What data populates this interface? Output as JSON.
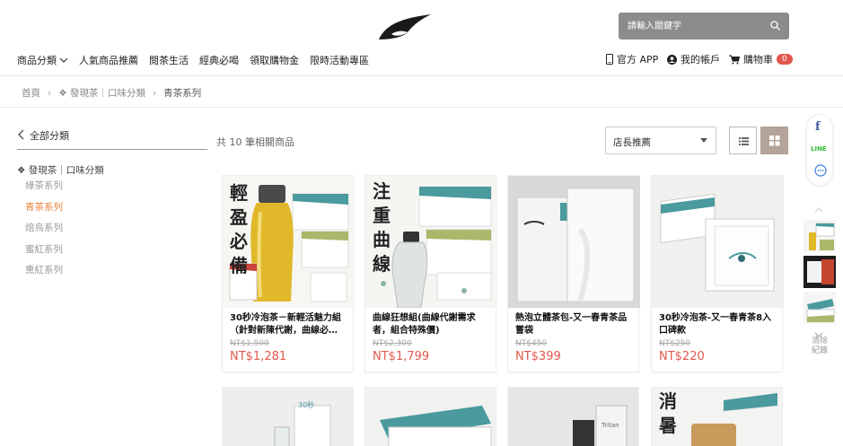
{
  "search": {
    "placeholder": "請輸入關鍵字"
  },
  "nav": {
    "items": [
      "商品分類",
      "人氣商品推薦",
      "閱茶生活",
      "經典必喝",
      "領取購物金",
      "限時活動專區"
    ]
  },
  "header_right": {
    "app": "官方 APP",
    "account": "我的帳戶",
    "cart": "購物車",
    "cart_count": "0"
  },
  "breadcrumb": [
    "首頁",
    "❖ 發現茶｜口味分類",
    "青茶系列"
  ],
  "sidebar": {
    "all_label": "全部分類",
    "subhead": "❖ 發現茶｜口味分類",
    "items": [
      {
        "label": "綠茶系列",
        "active": false
      },
      {
        "label": "青茶系列",
        "active": true
      },
      {
        "label": "焙烏系列",
        "active": false
      },
      {
        "label": "蜜紅系列",
        "active": false
      },
      {
        "label": "熏紅系列",
        "active": false
      }
    ]
  },
  "toolbar": {
    "count_text": "共 10 筆相關商品",
    "sort_selected": "店長推薦"
  },
  "products": [
    {
      "name": "30秒冷泡茶－新輕活魅力組（針對新陳代謝，曲線必…",
      "orig_price": "NT$1,500",
      "price": "NT$1,281",
      "vertical_text": "輕盈必備"
    },
    {
      "name": "曲線狂想組(曲線代謝需求者，組合特殊價)",
      "orig_price": "NT$2,300",
      "price": "NT$1,799",
      "vertical_text": "注重曲線"
    },
    {
      "name": "熱泡立體茶包-又一春青茶品嘗袋",
      "orig_price": "NT$450",
      "price": "NT$399"
    },
    {
      "name": "30秒冷泡茶-又一春青茶8入口碑款",
      "orig_price": "NT$250",
      "price": "NT$220"
    }
  ],
  "products_row2": [
    {
      "badge": "30秒"
    },
    {},
    {
      "label": "Tritan"
    },
    {
      "vertical_text": "消暑"
    }
  ],
  "side_widget": {
    "facebook": "f",
    "line": "LINE",
    "clear_label": "清除紀錄"
  },
  "colors": {
    "accent": "#e8823a",
    "price": "#e2574c",
    "search_bg": "#8c8c8c",
    "grid_btn": "#b3a398"
  }
}
